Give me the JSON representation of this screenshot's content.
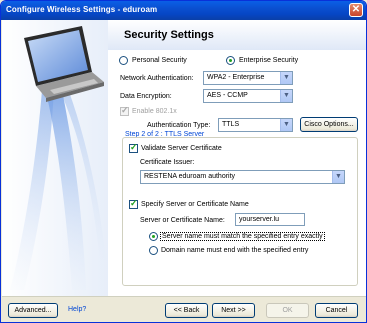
{
  "window": {
    "title": "Configure Wireless Settings - eduroam"
  },
  "header": {
    "title": "Security Settings"
  },
  "security_mode": {
    "personal_label": "Personal Security",
    "enterprise_label": "Enterprise Security",
    "selected": "enterprise"
  },
  "network_auth": {
    "label": "Network Authentication:",
    "value": "WPA2 - Enterprise"
  },
  "data_encryption": {
    "label": "Data Encryption:",
    "value": "AES - CCMP"
  },
  "enable_8021x": {
    "label": "Enable 802.1x",
    "checked": true,
    "enabled": false
  },
  "auth_type": {
    "label": "Authentication Type:",
    "value": "TTLS",
    "cisco_button": "Cisco Options..."
  },
  "step": {
    "label": "Step 2 of 2 : TTLS Server"
  },
  "validate_cert": {
    "label": "Validate Server Certificate",
    "checked": true
  },
  "cert_issuer": {
    "label": "Certificate Issuer:",
    "value": "RESTENA eduroam authority"
  },
  "specify_server": {
    "label": "Specify Server or Certificate Name",
    "checked": true
  },
  "server_name": {
    "label": "Server or Certificate Name:",
    "value": "yourserver.lu"
  },
  "match_options": {
    "exact_label": "Server name must match the specified entry exactly",
    "domain_label": "Domain name must end with the specified entry",
    "selected": "exact"
  },
  "footer": {
    "advanced": "Advanced...",
    "help": "Help?",
    "back": "<< Back",
    "next": "Next >>",
    "ok": "OK",
    "cancel": "Cancel"
  }
}
